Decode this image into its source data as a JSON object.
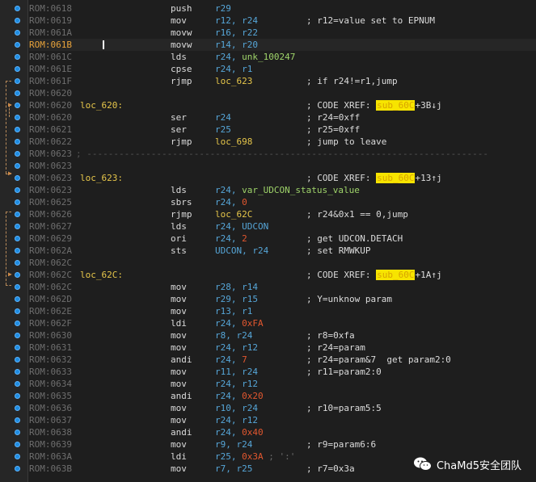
{
  "listing": [
    {
      "addr": "ROM:0618",
      "mn": "push",
      "ops": [
        [
          "r29",
          "reg"
        ]
      ]
    },
    {
      "addr": "ROM:0619",
      "mn": "mov",
      "ops": [
        [
          "r12, r24",
          "reg"
        ]
      ],
      "cmt": "; r12=value set to EPNUM"
    },
    {
      "addr": "ROM:061A",
      "mn": "movw",
      "ops": [
        [
          "r16, r22",
          "reg"
        ]
      ]
    },
    {
      "addr": "ROM:061B",
      "mn": "movw",
      "ops": [
        [
          "r14, r20",
          "reg"
        ]
      ],
      "current": true
    },
    {
      "addr": "ROM:061C",
      "mn": "lds",
      "ops": [
        [
          "r24, ",
          "reg"
        ],
        [
          "unk_100247",
          "nm"
        ]
      ]
    },
    {
      "addr": "ROM:061E",
      "mn": "cpse",
      "ops": [
        [
          "r24, r1",
          "reg"
        ]
      ]
    },
    {
      "addr": "ROM:061F",
      "mn": "rjmp",
      "ops": [
        [
          "loc_623",
          "lbl"
        ]
      ],
      "cmt": "; if r24!=r1,jump"
    },
    {
      "addr": "ROM:0620"
    },
    {
      "addr": "ROM:0620",
      "label": "loc_620:",
      "cmt": "; CODE XREF: ",
      "xref": "sub_60C",
      "xref_tail": "+3B↓j"
    },
    {
      "addr": "ROM:0620",
      "mn": "ser",
      "ops": [
        [
          "r24",
          "reg"
        ]
      ],
      "cmt": "; r24=0xff"
    },
    {
      "addr": "ROM:0621",
      "mn": "ser",
      "ops": [
        [
          "r25",
          "reg"
        ]
      ],
      "cmt": "; r25=0xff"
    },
    {
      "addr": "ROM:0622",
      "mn": "rjmp",
      "ops": [
        [
          "loc_698",
          "lbl"
        ]
      ],
      "cmt": "; jump to leave"
    },
    {
      "addr": "ROM:0623",
      "sep": true
    },
    {
      "addr": "ROM:0623"
    },
    {
      "addr": "ROM:0623",
      "label": "loc_623:",
      "cmt": "; CODE XREF: ",
      "xref": "sub_60C",
      "xref_tail": "+13↑j"
    },
    {
      "addr": "ROM:0623",
      "mn": "lds",
      "ops": [
        [
          "r24, ",
          "reg"
        ],
        [
          "var_UDCON_status_value",
          "nm"
        ]
      ]
    },
    {
      "addr": "ROM:0625",
      "mn": "sbrs",
      "ops": [
        [
          "r24, ",
          "reg"
        ],
        [
          "0",
          "num"
        ]
      ]
    },
    {
      "addr": "ROM:0626",
      "mn": "rjmp",
      "ops": [
        [
          "loc_62C",
          "lbl"
        ]
      ],
      "cmt": "; r24&0x1 == 0,jump"
    },
    {
      "addr": "ROM:0627",
      "mn": "lds",
      "ops": [
        [
          "r24, UDCON",
          "reg"
        ]
      ]
    },
    {
      "addr": "ROM:0629",
      "mn": "ori",
      "ops": [
        [
          "r24, ",
          "reg"
        ],
        [
          "2",
          "num"
        ]
      ],
      "cmt": "; get UDCON.DETACH"
    },
    {
      "addr": "ROM:062A",
      "mn": "sts",
      "ops": [
        [
          "UDCON, r24",
          "reg"
        ]
      ],
      "cmt": "; set RMWKUP"
    },
    {
      "addr": "ROM:062C"
    },
    {
      "addr": "ROM:062C",
      "label": "loc_62C:",
      "cmt": "; CODE XREF: ",
      "xref": "sub_60C",
      "xref_tail": "+1A↑j"
    },
    {
      "addr": "ROM:062C",
      "mn": "mov",
      "ops": [
        [
          "r28, r14",
          "reg"
        ]
      ]
    },
    {
      "addr": "ROM:062D",
      "mn": "mov",
      "ops": [
        [
          "r29, r15",
          "reg"
        ]
      ],
      "cmt": "; Y=unknow param"
    },
    {
      "addr": "ROM:062E",
      "mn": "mov",
      "ops": [
        [
          "r13, r1",
          "reg"
        ]
      ]
    },
    {
      "addr": "ROM:062F",
      "mn": "ldi",
      "ops": [
        [
          "r24, ",
          "reg"
        ],
        [
          "0xFA",
          "num"
        ]
      ]
    },
    {
      "addr": "ROM:0630",
      "mn": "mov",
      "ops": [
        [
          "r8, r24",
          "reg"
        ]
      ],
      "cmt": "; r8=0xfa"
    },
    {
      "addr": "ROM:0631",
      "mn": "mov",
      "ops": [
        [
          "r24, r12",
          "reg"
        ]
      ],
      "cmt": "; r24=param"
    },
    {
      "addr": "ROM:0632",
      "mn": "andi",
      "ops": [
        [
          "r24, ",
          "reg"
        ],
        [
          "7",
          "num"
        ]
      ],
      "cmt": "; r24=param&7  get param2:0"
    },
    {
      "addr": "ROM:0633",
      "mn": "mov",
      "ops": [
        [
          "r11, r24",
          "reg"
        ]
      ],
      "cmt": "; r11=param2:0"
    },
    {
      "addr": "ROM:0634",
      "mn": "mov",
      "ops": [
        [
          "r24, r12",
          "reg"
        ]
      ]
    },
    {
      "addr": "ROM:0635",
      "mn": "andi",
      "ops": [
        [
          "r24, ",
          "reg"
        ],
        [
          "0x20",
          "num"
        ]
      ]
    },
    {
      "addr": "ROM:0636",
      "mn": "mov",
      "ops": [
        [
          "r10, r24",
          "reg"
        ]
      ],
      "cmt": "; r10=param5:5"
    },
    {
      "addr": "ROM:0637",
      "mn": "mov",
      "ops": [
        [
          "r24, r12",
          "reg"
        ]
      ]
    },
    {
      "addr": "ROM:0638",
      "mn": "andi",
      "ops": [
        [
          "r24, ",
          "reg"
        ],
        [
          "0x40",
          "num"
        ]
      ]
    },
    {
      "addr": "ROM:0639",
      "mn": "mov",
      "ops": [
        [
          "r9, r24",
          "reg"
        ]
      ],
      "cmt": "; r9=param6:6"
    },
    {
      "addr": "ROM:063A",
      "mn": "ldi",
      "ops": [
        [
          "r25, ",
          "reg"
        ],
        [
          "0x3A",
          "num"
        ],
        [
          " ; ':'",
          "cm"
        ]
      ]
    },
    {
      "addr": "ROM:063B",
      "mn": "mov",
      "ops": [
        [
          "r7, r25",
          "reg"
        ]
      ],
      "cmt": "; r7=0x3a"
    }
  ],
  "separator_text": "; ---------------------------------------------------------------------------",
  "watermark": {
    "text": "ChaMd5安全团队",
    "icon": "wechat-icon"
  },
  "colors": {
    "background": "#1e1e1e",
    "address": "#6e6e6e",
    "label": "#e6c64a",
    "register": "#56a6d8",
    "number": "#e2572f",
    "xref_highlight": "#f7e400"
  }
}
